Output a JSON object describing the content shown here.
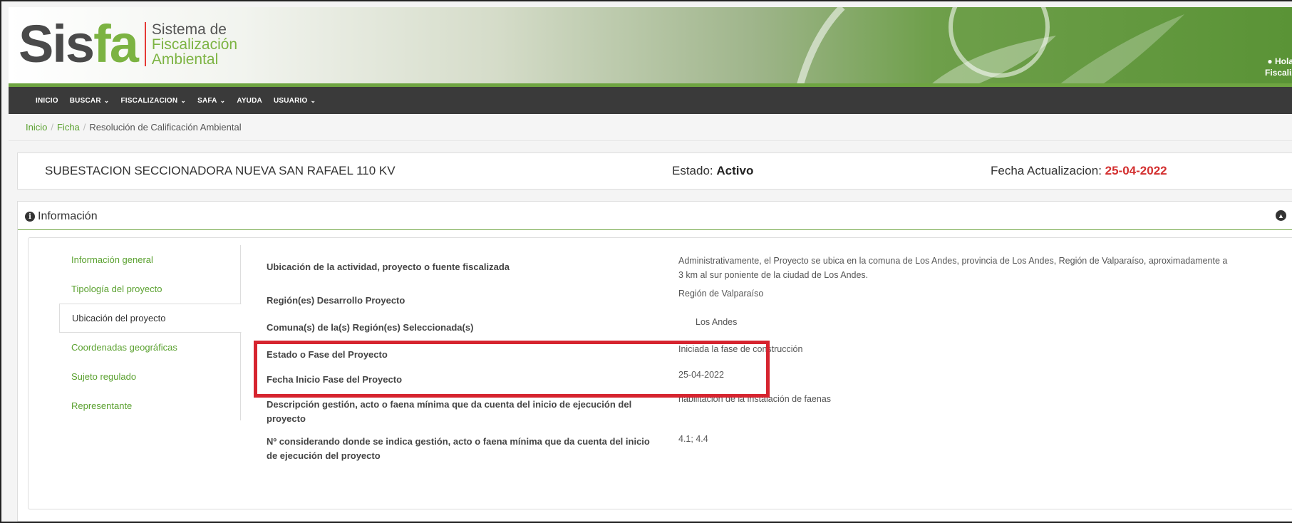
{
  "header": {
    "logo": {
      "sis": "Sis",
      "fa": "fa",
      "line1": "Sistema de",
      "line2": "Fiscalización",
      "line3": "Ambiental"
    },
    "greeting": {
      "line1": "Hola",
      "line2": "Fiscaliz"
    }
  },
  "nav": {
    "items": [
      {
        "label": "INICIO",
        "dropdown": false
      },
      {
        "label": "BUSCAR",
        "dropdown": true
      },
      {
        "label": "FISCALIZACION",
        "dropdown": true
      },
      {
        "label": "SAFA",
        "dropdown": true
      },
      {
        "label": "AYUDA",
        "dropdown": false
      },
      {
        "label": "USUARIO",
        "dropdown": true
      }
    ]
  },
  "breadcrumb": {
    "item1": "Inicio",
    "item2": "Ficha",
    "current": "Resolución de Calificación Ambiental"
  },
  "titlebar": {
    "project": "SUBESTACION SECCIONADORA NUEVA SAN RAFAEL 110 KV",
    "estado_label": "Estado: ",
    "estado_value": "Activo",
    "fecha_label": "Fecha Actualizacion: ",
    "fecha_value": "25-04-2022"
  },
  "panel": {
    "title": "Información",
    "tabs": [
      "Información general",
      "Tipología del proyecto",
      "Ubicación del proyecto",
      "Coordenadas geográficas",
      "Sujeto regulado",
      "Representante"
    ],
    "active_tab": "Ubicación del proyecto",
    "rows": [
      {
        "label": "Ubicación de la actividad, proyecto o fuente fiscalizada",
        "value": "Administrativamente, el Proyecto se ubica en la comuna de Los Andes, provincia de Los Andes, Región de Valparaíso, aproximadamente a 3 km al sur poniente de la ciudad de Los Andes."
      },
      {
        "label": "Región(es) Desarrollo Proyecto",
        "value": "Región de Valparaíso"
      },
      {
        "label": "Comuna(s) de la(s) Región(es) Seleccionada(s)",
        "value": "Los Andes"
      },
      {
        "label": "Estado o Fase del Proyecto",
        "value": "Iniciada la fase de construcción"
      },
      {
        "label": "Fecha Inicio Fase del Proyecto",
        "value": "25-04-2022"
      },
      {
        "label": "Descripción gestión, acto o faena mínima que da cuenta del inicio de ejecución del proyecto",
        "value": "habilitación de la instalación de faenas"
      },
      {
        "label": "Nº considerando donde se indica gestión, acto o faena mínima que da cuenta del inicio de ejecución del proyecto",
        "value": "4.1; 4.4"
      }
    ]
  },
  "colors": {
    "green": "#6ea441",
    "link": "#5aa12f",
    "red": "#d32f2f",
    "nav_bg": "#3a3a3a",
    "highlight": "#d6242f"
  },
  "icons": [
    "user-icon",
    "chevron-down-icon",
    "info-icon",
    "chevron-up-icon"
  ]
}
